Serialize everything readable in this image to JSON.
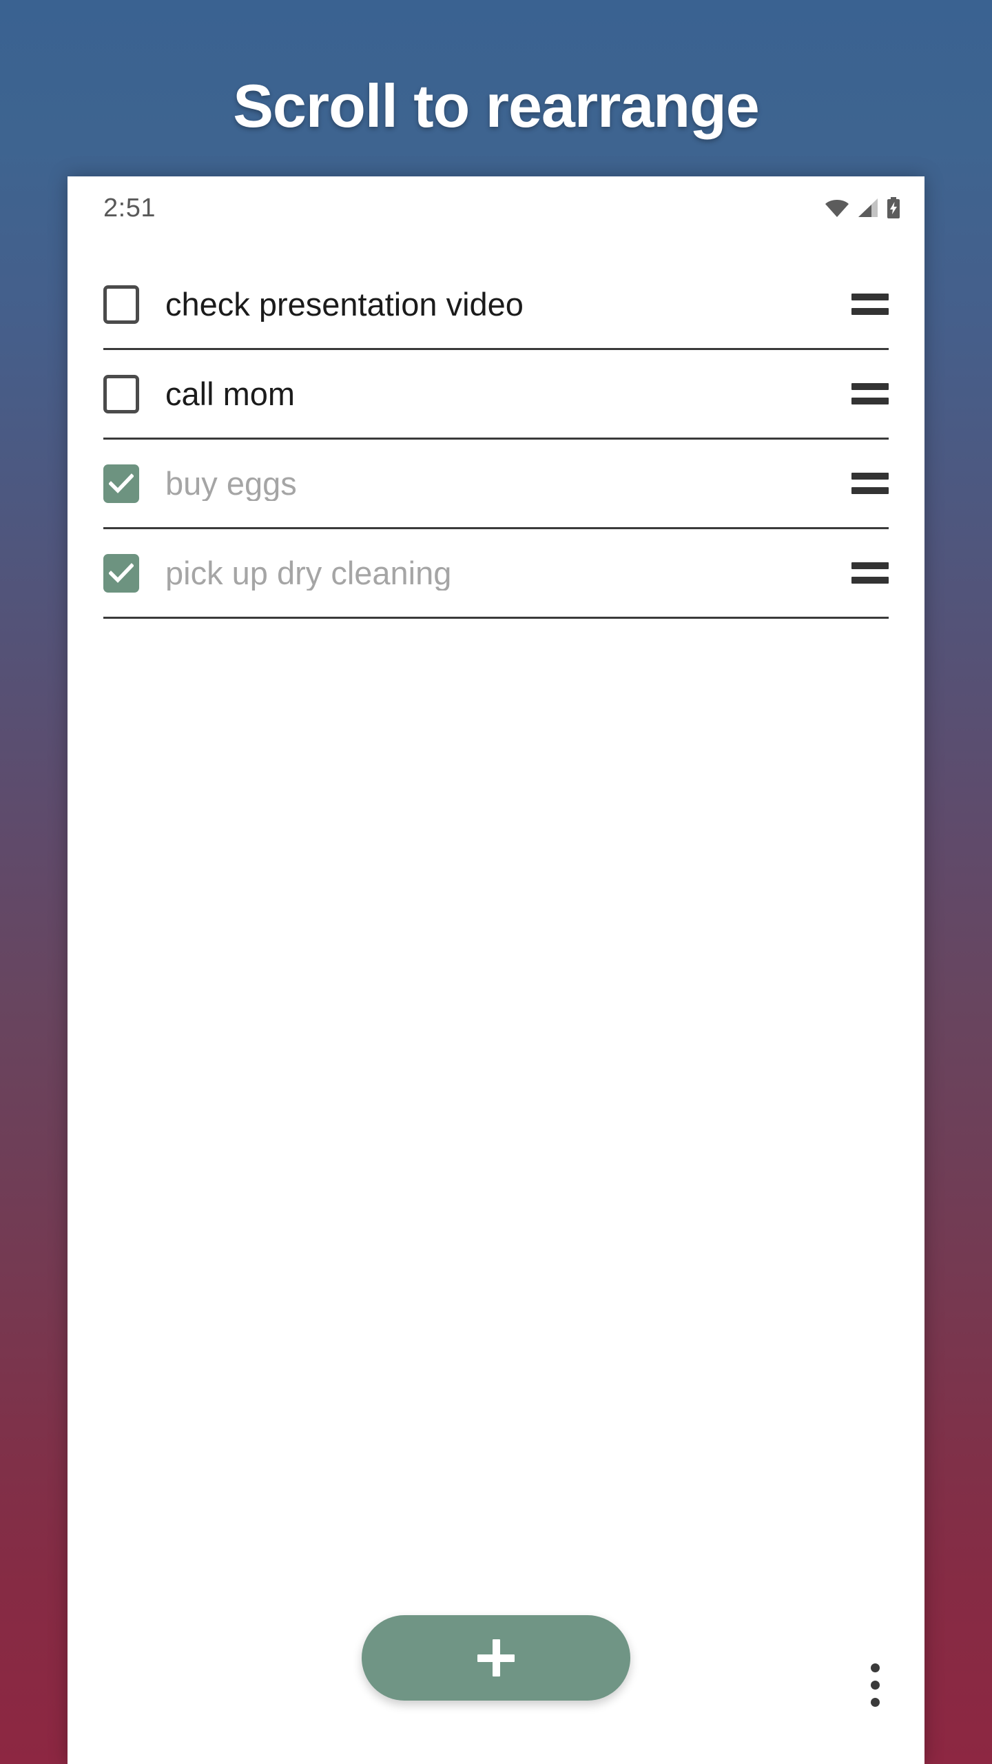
{
  "promo": {
    "title": "Scroll to rearrange",
    "background_top_color": "#3A6291",
    "background_mid_color": "#604A6A",
    "background_bottom_color": "#8D2742"
  },
  "status_bar": {
    "time": "2:51",
    "icons": [
      "wifi-icon",
      "cellular-signal-icon",
      "battery-charging-icon"
    ]
  },
  "tasks": [
    {
      "label": "check presentation video",
      "checked": false
    },
    {
      "label": "call mom",
      "checked": false
    },
    {
      "label": "buy eggs",
      "checked": true
    },
    {
      "label": "pick up dry cleaning",
      "checked": true
    }
  ],
  "bottom_bar": {
    "add_task_icon": "plus-icon",
    "overflow_icon": "more-vertical-icon"
  },
  "colors": {
    "accent_green": "#709585",
    "checkbox_checked": "#6D9380",
    "task_text_active": "#1B1B1B",
    "task_text_done": "#A5A5A5",
    "divider": "#3A3A3A"
  }
}
